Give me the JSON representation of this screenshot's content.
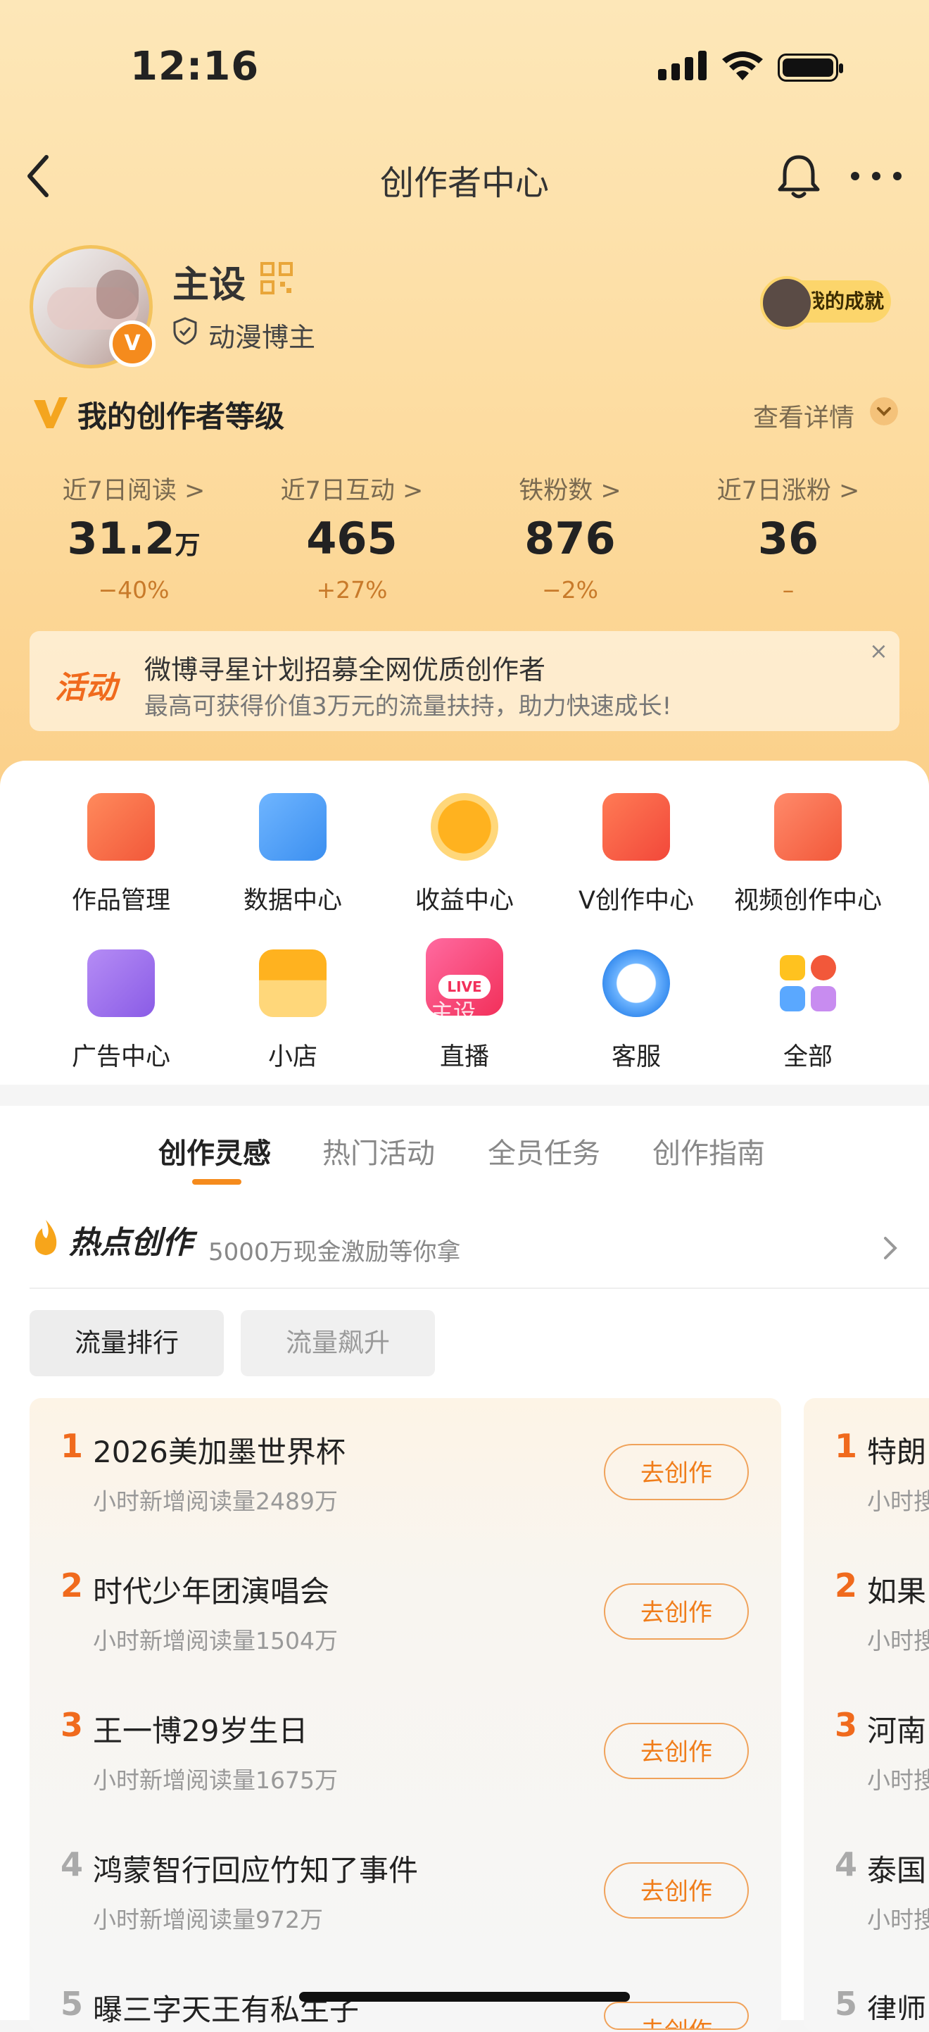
{
  "status_bar": {
    "time": "12:16"
  },
  "nav": {
    "title": "创作者中心"
  },
  "profile": {
    "name": "主设",
    "badge_letter": "V",
    "tag": "动漫博主",
    "achievement": "我的成就"
  },
  "level": {
    "title": "我的创作者等级",
    "detail": "查看详情"
  },
  "stats": [
    {
      "label": "近7日阅读 >",
      "value": "31.2",
      "unit": "万",
      "change": "−40%"
    },
    {
      "label": "近7日互动 >",
      "value": "465",
      "unit": "",
      "change": "+27%"
    },
    {
      "label": "铁粉数 >",
      "value": "876",
      "unit": "",
      "change": "−2%"
    },
    {
      "label": "近7日涨粉 >",
      "value": "36",
      "unit": "",
      "change": "–"
    }
  ],
  "banner": {
    "tag": "活动",
    "line1": "微博寻星计划招募全网优质创作者",
    "line2": "最高可获得价值3万元的流量扶持，助力快速成长!",
    "close": "×"
  },
  "tools": [
    {
      "label": "作品管理",
      "color": "#f4622e"
    },
    {
      "label": "数据中心",
      "color": "#3b8ff0"
    },
    {
      "label": "收益中心",
      "color": "#f7a51b"
    },
    {
      "label": "V创作中心",
      "color": "#f2583a"
    },
    {
      "label": "视频创作中心",
      "color": "#f2583a"
    },
    {
      "label": "广告中心",
      "color": "#9b6be8"
    },
    {
      "label": "小店",
      "color": "#f7a51b"
    },
    {
      "label": "直播",
      "color": "#f2497a"
    },
    {
      "label": "客服",
      "color": "#3b8ff0"
    },
    {
      "label": "全部",
      "color": "#f2583a"
    }
  ],
  "live_badge": "LIVE",
  "watermark": "@主设",
  "tabs": [
    "创作灵感",
    "热门活动",
    "全员任务",
    "创作指南"
  ],
  "hot": {
    "title": "热点创作",
    "subtitle": "5000万现金激励等你拿"
  },
  "chips": [
    "流量排行",
    "流量飙升"
  ],
  "ranking": [
    {
      "rank": "1",
      "title": "2026美加墨世界杯",
      "sub": "小时新增阅读量2489万",
      "button": "去创作"
    },
    {
      "rank": "2",
      "title": "时代少年团演唱会",
      "sub": "小时新增阅读量1504万",
      "button": "去创作"
    },
    {
      "rank": "3",
      "title": "王一博29岁生日",
      "sub": "小时新增阅读量1675万",
      "button": "去创作"
    },
    {
      "rank": "4",
      "title": "鸿蒙智行回应竹知了事件",
      "sub": "小时新增阅读量972万",
      "button": "去创作"
    },
    {
      "rank": "5",
      "title": "曝三字天王有私生子",
      "sub": "",
      "button": "去创作"
    }
  ],
  "ranking2": [
    {
      "rank": "1",
      "title": "特朗",
      "sub": "小时搜"
    },
    {
      "rank": "2",
      "title": "如果",
      "sub": "小时搜"
    },
    {
      "rank": "3",
      "title": "河南",
      "sub": "小时搜"
    },
    {
      "rank": "4",
      "title": "泰国",
      "sub": "小时搜"
    },
    {
      "rank": "5",
      "title": "律师",
      "sub": ""
    }
  ],
  "colors": {
    "accent": "#f58b1d",
    "rank_top": "#f06a1d",
    "rank_other": "#aaaaaa"
  }
}
